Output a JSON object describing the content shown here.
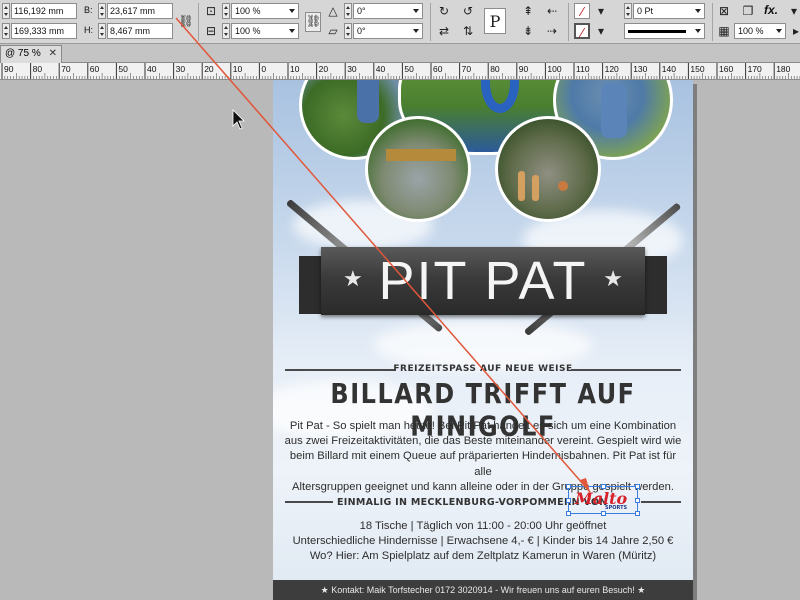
{
  "control_panel": {
    "x_value": "116,192 mm",
    "y_value": "169,333 mm",
    "w_label": "B:",
    "w_value": "23,617 mm",
    "h_label": "H:",
    "h_value": "8,467 mm",
    "scale_x": "100 %",
    "scale_y": "100 %",
    "rotate": "0°",
    "shear": "0°",
    "stroke_weight": "0 Pt",
    "opacity": "100 %",
    "fx": "fx."
  },
  "tabs": [
    {
      "label": "@ 75 %",
      "close": "✕"
    }
  ],
  "ruler": {
    "labels": [
      "90",
      "80",
      "70",
      "60",
      "50",
      "40",
      "30",
      "20",
      "10",
      "0",
      "10",
      "20",
      "30",
      "40",
      "50",
      "60",
      "70",
      "80",
      "90",
      "100",
      "110",
      "120",
      "130",
      "140",
      "150",
      "160",
      "170",
      "180"
    ]
  },
  "poster": {
    "title": "PIT PAT",
    "star": "★",
    "subtitle": "FREIZEITSPASS AUF NEUE WEISE",
    "headline": "BILLARD TRIFFT AUF MINIGOLF",
    "body": [
      "Pit Pat - So spielt man heute! Bei Pit Pat handelt es sich um eine Kombination",
      "aus zwei Freizeitaktivitäten, die das Beste miteinander vereint. Gespielt wird wie",
      "beim Billard mit einem Queue auf präparierten Hindernisbahnen. Pit Pat ist für alle",
      "Altersgruppen geeignet und kann alleine oder in der Gruppe gespielt werden."
    ],
    "region_heading": "EINMALIG IN MECKLENBURG-VORPOMMERN VON",
    "logo_text": "Malto",
    "logo_sub": "SPORTS",
    "info": [
      "18 Tische | Täglich von 11:00 - 20:00 Uhr geöffnet",
      "Unterschiedliche Hindernisse | Erwachsene 4,- € | Kinder bis 14 Jahre 2,50 €",
      "Wo? Hier: Am Spielplatz auf dem Zeltplatz Kamerun in Waren (Müritz)"
    ],
    "footer": "★ Kontakt: Maik Torfstecher 0172 3020914 - Wir freuen uns auf euren Besuch! ★"
  },
  "colors": {
    "banner": "#3b3b3b",
    "text": "#2d2d2d",
    "logo_red": "#d8222a",
    "selection_blue": "#3c7de0",
    "guide_line": "#e0573a"
  }
}
